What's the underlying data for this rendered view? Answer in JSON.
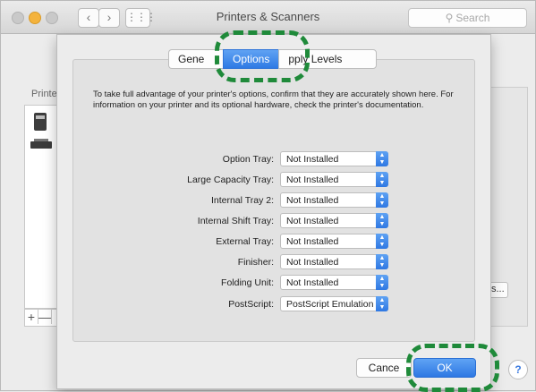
{
  "window": {
    "title": "Printers & Scanners",
    "nav_back": "‹",
    "nav_forward": "›",
    "grid_icon": "⋮⋮⋮",
    "search_placeholder": "Search"
  },
  "background": {
    "printers_label": "Printe",
    "add_label": "+",
    "remove_label": "—",
    "options_button_fragment": "s...",
    "help_label": "?"
  },
  "sheet": {
    "tabs": [
      {
        "label": "Gene",
        "active": false
      },
      {
        "label": "Options",
        "active": true
      },
      {
        "label": "pply Levels",
        "active": false
      }
    ],
    "intro_text": "To take full advantage of your printer's options, confirm that they are accurately shown here. For information on your printer and its optional hardware, check the printer's documentation.",
    "options": [
      {
        "label": "Option Tray:",
        "value": "Not Installed"
      },
      {
        "label": "Large Capacity Tray:",
        "value": "Not Installed"
      },
      {
        "label": "Internal Tray 2:",
        "value": "Not Installed"
      },
      {
        "label": "Internal Shift Tray:",
        "value": "Not Installed"
      },
      {
        "label": "External Tray:",
        "value": "Not Installed"
      },
      {
        "label": "Finisher:",
        "value": "Not Installed"
      },
      {
        "label": "Folding Unit:",
        "value": "Not Installed"
      },
      {
        "label": "PostScript:",
        "value": "PostScript Emulation"
      }
    ],
    "cancel_label": "Cance",
    "ok_label": "OK"
  },
  "colors": {
    "accent_blue": "#2f7ae4",
    "highlight_green": "#1f8a3a"
  }
}
